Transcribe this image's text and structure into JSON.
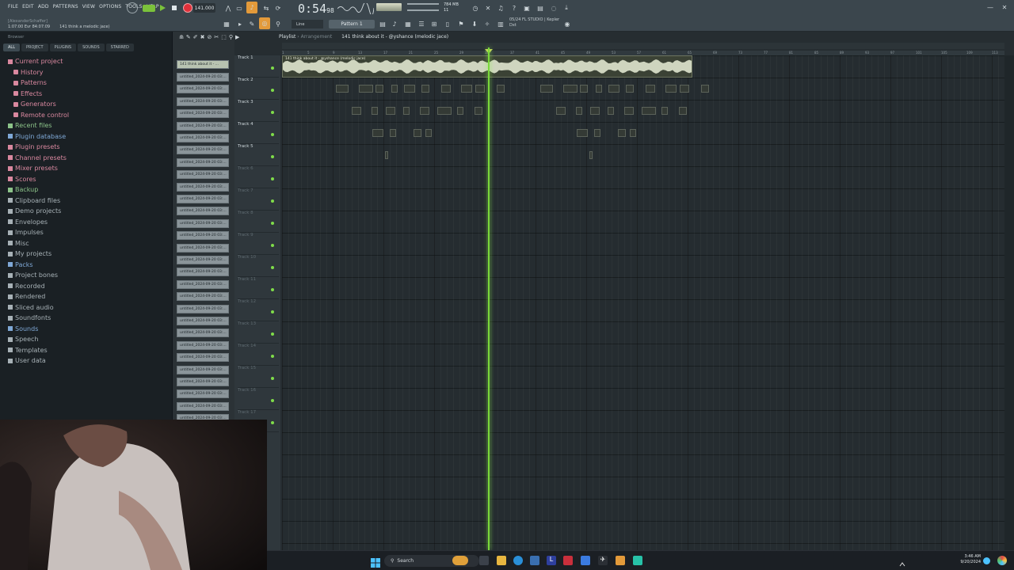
{
  "menu": [
    "FILE",
    "EDIT",
    "ADD",
    "PATTERNS",
    "VIEW",
    "OPTIONS",
    "TOOLS",
    "HELP"
  ],
  "toolbar": {
    "tempo": "141.000",
    "time_main": "0:54",
    "time_small": "98",
    "hint_user": "[AlexanderSchaffer]",
    "hint_pos": "1:07:00 Evr 84:07:09",
    "hint_project": "141 think a melodic jace)",
    "snap": "Line",
    "pattern": "Pattern 1",
    "cpu_mem": "784 MB",
    "cpu_num": "11",
    "fl_version": "FL STUDIO | Kepler",
    "fl_date": "05/24",
    "fl_extra": "Dxt"
  },
  "browser": {
    "title": "Browser",
    "tabs": [
      "ALL",
      "PROJECT",
      "PLUGINS",
      "SOUNDS",
      "STARRED"
    ],
    "items": [
      {
        "label": "Current project",
        "level": 0,
        "color": "pink"
      },
      {
        "label": "History",
        "level": 1,
        "color": "pink"
      },
      {
        "label": "Patterns",
        "level": 1,
        "color": "pink"
      },
      {
        "label": "Effects",
        "level": 1,
        "color": "pink"
      },
      {
        "label": "Generators",
        "level": 1,
        "color": "pink"
      },
      {
        "label": "Remote control",
        "level": 1,
        "color": "pink"
      },
      {
        "label": "Recent files",
        "level": 0,
        "color": "green"
      },
      {
        "label": "Plugin database",
        "level": 0,
        "color": "blue"
      },
      {
        "label": "Plugin presets",
        "level": 0,
        "color": "pink"
      },
      {
        "label": "Channel presets",
        "level": 0,
        "color": "pink"
      },
      {
        "label": "Mixer presets",
        "level": 0,
        "color": "pink"
      },
      {
        "label": "Scores",
        "level": 0,
        "color": "pink"
      },
      {
        "label": "Backup",
        "level": 0,
        "color": "green"
      },
      {
        "label": "Clipboard files",
        "level": 0,
        "color": "gray"
      },
      {
        "label": "Demo projects",
        "level": 0,
        "color": "gray"
      },
      {
        "label": "Envelopes",
        "level": 0,
        "color": "gray"
      },
      {
        "label": "Impulses",
        "level": 0,
        "color": "gray"
      },
      {
        "label": "Misc",
        "level": 0,
        "color": "gray"
      },
      {
        "label": "My projects",
        "level": 0,
        "color": "gray"
      },
      {
        "label": "Packs",
        "level": 0,
        "color": "blue"
      },
      {
        "label": "Project bones",
        "level": 0,
        "color": "gray"
      },
      {
        "label": "Recorded",
        "level": 0,
        "color": "gray"
      },
      {
        "label": "Rendered",
        "level": 0,
        "color": "gray"
      },
      {
        "label": "Sliced audio",
        "level": 0,
        "color": "gray"
      },
      {
        "label": "Soundfonts",
        "level": 0,
        "color": "gray"
      },
      {
        "label": "Sounds",
        "level": 0,
        "color": "blue"
      },
      {
        "label": "Speech",
        "level": 0,
        "color": "gray"
      },
      {
        "label": "Templates",
        "level": 0,
        "color": "gray"
      },
      {
        "label": "User data",
        "level": 0,
        "color": "gray"
      }
    ]
  },
  "items_col": {
    "first": "141 think about it - ...",
    "clips": [
      "untitled_2024-09-20 03:...",
      "untitled_2024-09-20 03:...",
      "untitled_2024-09-20 03:...",
      "untitled_2024-09-20 03:...",
      "untitled_2024-09-20 03:...",
      "untitled_2024-09-20 03:...",
      "untitled_2024-09-20 03:...",
      "untitled_2024-09-20 03:...",
      "untitled_2024-09-20 03:...",
      "untitled_2024-09-20 03:...",
      "untitled_2024-09-20 03:...",
      "untitled_2024-09-20 03:...",
      "untitled_2024-09-20 03:...",
      "untitled_2024-09-20 03:...",
      "untitled_2024-09-20 03:...",
      "untitled_2024-09-20 03:...",
      "untitled_2024-09-20 03:...",
      "untitled_2024-09-20 03:...",
      "untitled_2024-09-20 03:...",
      "untitled_2024-09-20 03:...",
      "untitled_2024-09-20 03:...",
      "untitled_2024-09-20 03:...",
      "untitled_2024-09-20 03:...",
      "untitled_2024-09-20 03:...",
      "untitled_2024-09-20 03:...",
      "untitled_2024-09-20 03:...",
      "untitled_2024-09-20 03:...",
      "untitled_2024-09-20 03:...",
      "untitled_2024-09-20 03:..."
    ]
  },
  "playlist": {
    "title": "Playlist",
    "subtitle": "Arrangement",
    "song": "141 think about it - @yshance (melodic jace)",
    "main_clip_label": "141 think about it - @yshance (melodic jace)",
    "tracks": [
      "Track 1",
      "Track 2",
      "Track 3",
      "Track 4",
      "Track 5",
      "Track 6",
      "Track 7",
      "Track 8",
      "Track 9",
      "Track 10",
      "Track 11",
      "Track 12",
      "Track 13",
      "Track 14",
      "Track 15",
      "Track 16",
      "Track 17"
    ],
    "ruler": [
      "1",
      "5",
      "9",
      "13",
      "17",
      "21",
      "25",
      "29",
      "33",
      "37",
      "41",
      "45",
      "49",
      "53",
      "57",
      "61",
      "65",
      "69",
      "73",
      "77",
      "81",
      "85",
      "89",
      "93",
      "97",
      "101",
      "105",
      "109",
      "113"
    ]
  },
  "taskbar": {
    "search": "Search",
    "time": "3:46 AM",
    "date": "9/20/2024"
  },
  "colors": {
    "accent_green": "#7ad83a",
    "record_red": "#e0303a",
    "toolbar_bg": "#3b464d"
  }
}
